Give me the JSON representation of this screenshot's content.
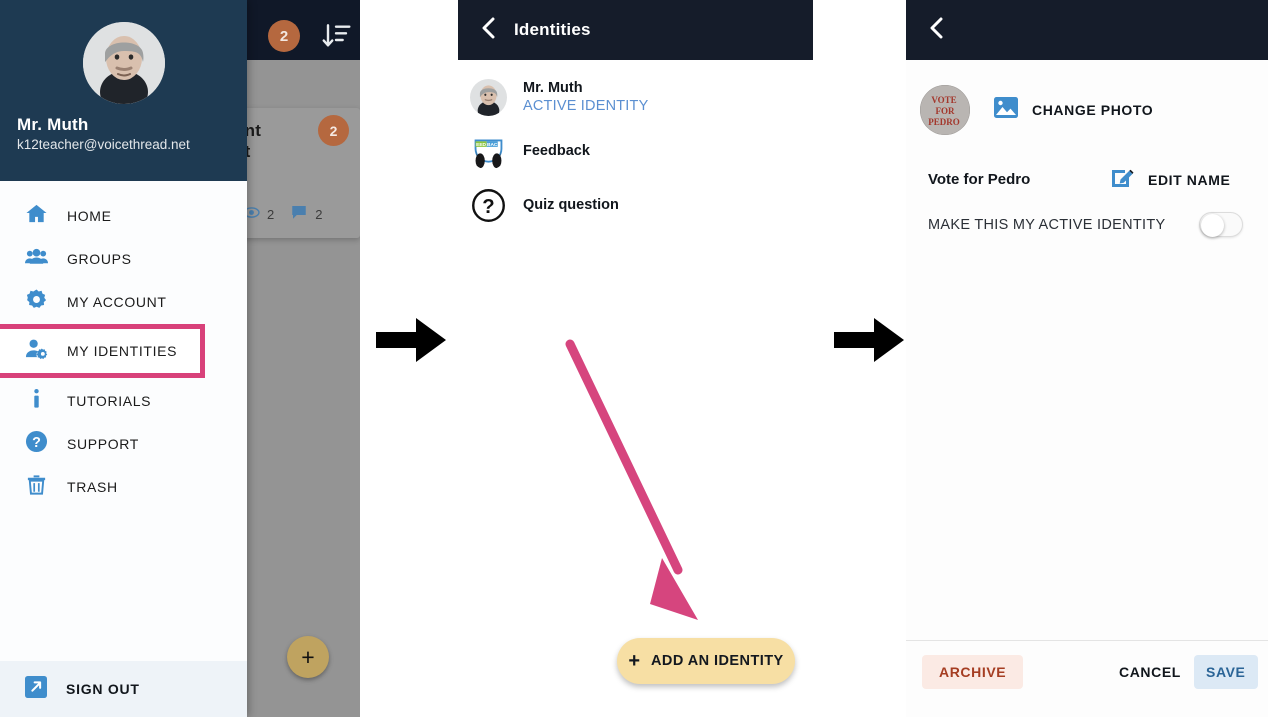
{
  "panel1": {
    "topbar": {
      "badge_count": "2",
      "sort_icon": "sort-descending-icon"
    },
    "profile": {
      "name": "Mr. Muth",
      "email": "k12teacher@voicethread.net",
      "avatar_icon": "user-photo-avatar"
    },
    "nav_items": [
      {
        "label": "HOME",
        "icon": "home-icon",
        "highlighted": false
      },
      {
        "label": "GROUPS",
        "icon": "groups-icon",
        "highlighted": false
      },
      {
        "label": "MY ACCOUNT",
        "icon": "gear-icon",
        "highlighted": false
      },
      {
        "label": "MY IDENTITIES",
        "icon": "user-gear-icon",
        "highlighted": true
      },
      {
        "label": "TUTORIALS",
        "icon": "info-icon",
        "highlighted": false
      },
      {
        "label": "SUPPORT",
        "icon": "question-circle-icon",
        "highlighted": false
      },
      {
        "label": "TRASH",
        "icon": "trash-icon",
        "highlighted": false
      }
    ],
    "sign_out": {
      "label": "SIGN OUT",
      "icon": "sign-out-icon"
    },
    "background_card": {
      "title_fragment_1": "ent",
      "title_fragment_2": "at",
      "badge_count": "2",
      "views_count": "2",
      "comments_count": "2",
      "views_icon": "eye-icon",
      "comments_icon": "comment-icon"
    },
    "fab": {
      "label": "+",
      "icon": "plus-icon"
    }
  },
  "panel2": {
    "header": {
      "title": "Identities",
      "back_icon": "chevron-left-icon"
    },
    "identities": [
      {
        "name": "Mr. Muth",
        "status": "ACTIVE IDENTITY",
        "avatar_icon": "user-photo-avatar"
      },
      {
        "name": "Feedback",
        "status": "",
        "avatar_icon": "feedback-logo-avatar"
      },
      {
        "name": "Quiz question",
        "status": "",
        "avatar_icon": "question-mark-avatar"
      }
    ],
    "add_button": {
      "label": "ADD AN IDENTITY",
      "plus": "+",
      "icon": "plus-icon"
    }
  },
  "panel3": {
    "header": {
      "back_icon": "chevron-left-icon"
    },
    "avatar_icon": "vote-for-pedro-avatar",
    "change_photo": {
      "label": "CHANGE PHOTO",
      "icon": "image-icon"
    },
    "identity_name": "Vote for Pedro",
    "edit_name": {
      "label": "EDIT NAME",
      "icon": "edit-pencil-icon"
    },
    "active_toggle": {
      "label": "MAKE THIS MY ACTIVE IDENTITY",
      "state": "off"
    },
    "actions": {
      "archive": "ARCHIVE",
      "cancel": "CANCEL",
      "save": "SAVE"
    }
  },
  "annotations": {
    "arrow_1": "black-right-arrow",
    "arrow_2": "black-right-arrow",
    "pink_arrow": "pink-pointer-arrow"
  },
  "colors": {
    "accent_pink": "#d8417a",
    "header_navy": "#151c2a",
    "profile_navy": "#1e3a52",
    "icon_blue": "#3f8dcc",
    "badge_orange": "#b5683f",
    "add_button_yellow": "#f7dfa4",
    "archive_red": "#a53d22",
    "save_blue": "#2a6496"
  }
}
